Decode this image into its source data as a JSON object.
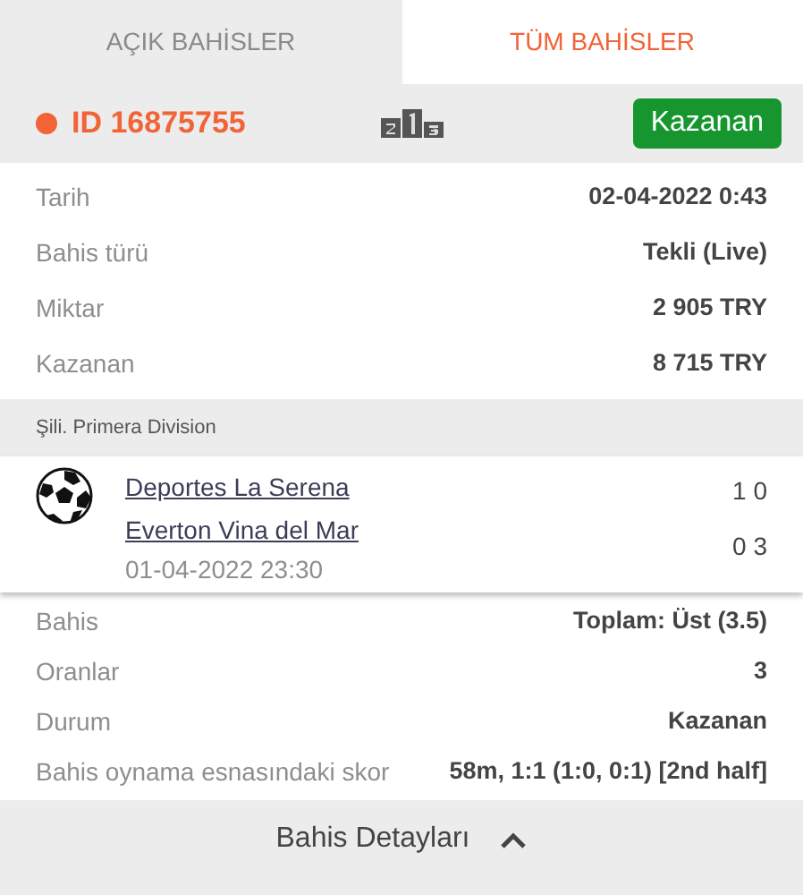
{
  "tabs": [
    {
      "label": "AÇIK BAHİSLER",
      "selected": false
    },
    {
      "label": "TÜM BAHİSLER",
      "selected": true
    }
  ],
  "bet": {
    "id": "ID 16875755",
    "color": "#f26336",
    "status": "Kazanan",
    "details": [
      {
        "label": "Tarih",
        "value": "02-04-2022 0:43"
      },
      {
        "label": "Bahis türü",
        "value": "Tekli (Live)"
      },
      {
        "label": "Miktar",
        "value": "2 905 TRY"
      },
      {
        "label": "Kazanan",
        "value": "8 715 TRY"
      }
    ],
    "league": "Şili. Primera Division",
    "match": {
      "teams": [
        {
          "name": "Deportes La Serena",
          "score": "1 0"
        },
        {
          "name": "Everton Vina del Mar",
          "score": "0 3"
        }
      ],
      "date": "01-04-2022 23:30"
    },
    "info": [
      {
        "label": "Bahis",
        "value": "Toplam: Üst (3.5)"
      },
      {
        "label": "Oranlar",
        "value": "3"
      },
      {
        "label": "Durum",
        "value": "Kazanan"
      },
      {
        "label": "Bahis oynama esnasındaki skor",
        "value": "58m, 1:1 (1:0, 0:1) [2nd half]"
      }
    ]
  },
  "footer": {
    "label": "Bahis Detayları",
    "expanded": true
  }
}
